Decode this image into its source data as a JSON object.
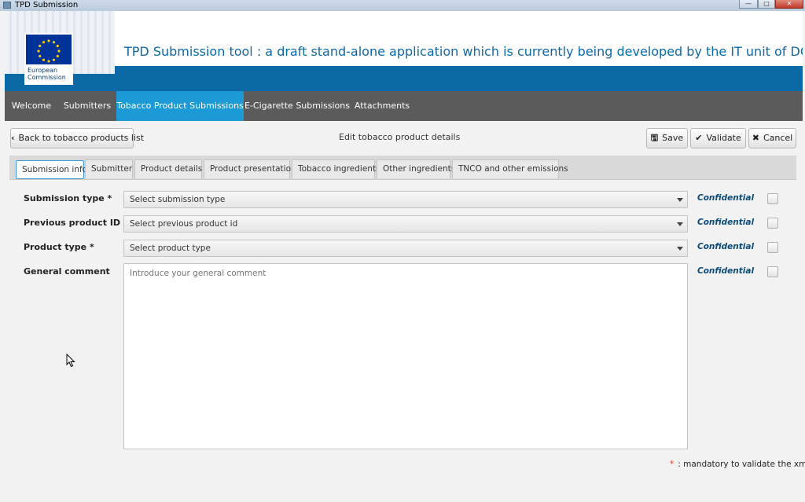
{
  "window": {
    "title": "TPD Submission",
    "minimize_icon": "minimize-icon",
    "maximize_icon": "maximize-icon",
    "close_icon": "close-icon"
  },
  "header": {
    "logo_text_line1": "European",
    "logo_text_line2": "Commission",
    "app_title": "TPD Submission tool : a draft stand-alone application which is currently being developed by the IT unit of DG SANTE",
    "title_color": "#0b69a6",
    "band_color": "#0b69a6"
  },
  "nav": {
    "items": [
      {
        "label": "Welcome"
      },
      {
        "label": "Submitters"
      },
      {
        "label": "Tobacco Product Submissions",
        "active": true
      },
      {
        "label": "E-Cigarette Submissions"
      },
      {
        "label": "Attachments"
      }
    ],
    "active_color": "#1c9ad6"
  },
  "toolbar": {
    "back_label": "Back to tobacco products list",
    "back_icon": "chevron-left-icon",
    "center_title": "Edit tobacco product details",
    "save_label": "Save",
    "save_icon": "floppy-disk-icon",
    "validate_label": "Validate",
    "validate_icon": "checkmark-icon",
    "cancel_label": "Cancel",
    "cancel_icon": "x-icon"
  },
  "tabs": [
    {
      "label": "Submission info",
      "active": true
    },
    {
      "label": "Submitter"
    },
    {
      "label": "Product details"
    },
    {
      "label": "Product presentation"
    },
    {
      "label": "Tobacco ingredients"
    },
    {
      "label": "Other ingredients"
    },
    {
      "label": "TNCO and other emissions"
    }
  ],
  "form": {
    "submission_type": {
      "label": "Submission type *",
      "value": "Select submission type",
      "confidential": "Confidential",
      "checked": false
    },
    "previous_product_id": {
      "label": "Previous product ID *",
      "value": "Select previous product id",
      "confidential": "Confidential",
      "checked": false
    },
    "product_type": {
      "label": "Product type *",
      "value": "Select product type",
      "confidential": "Confidential",
      "checked": false
    },
    "general_comment": {
      "label": "General comment",
      "placeholder": "Introduce your general comment",
      "confidential": "Confidential",
      "checked": false
    }
  },
  "footer": {
    "mandatory_star": "*",
    "mandatory_note": ": mandatory to validate the xml"
  }
}
